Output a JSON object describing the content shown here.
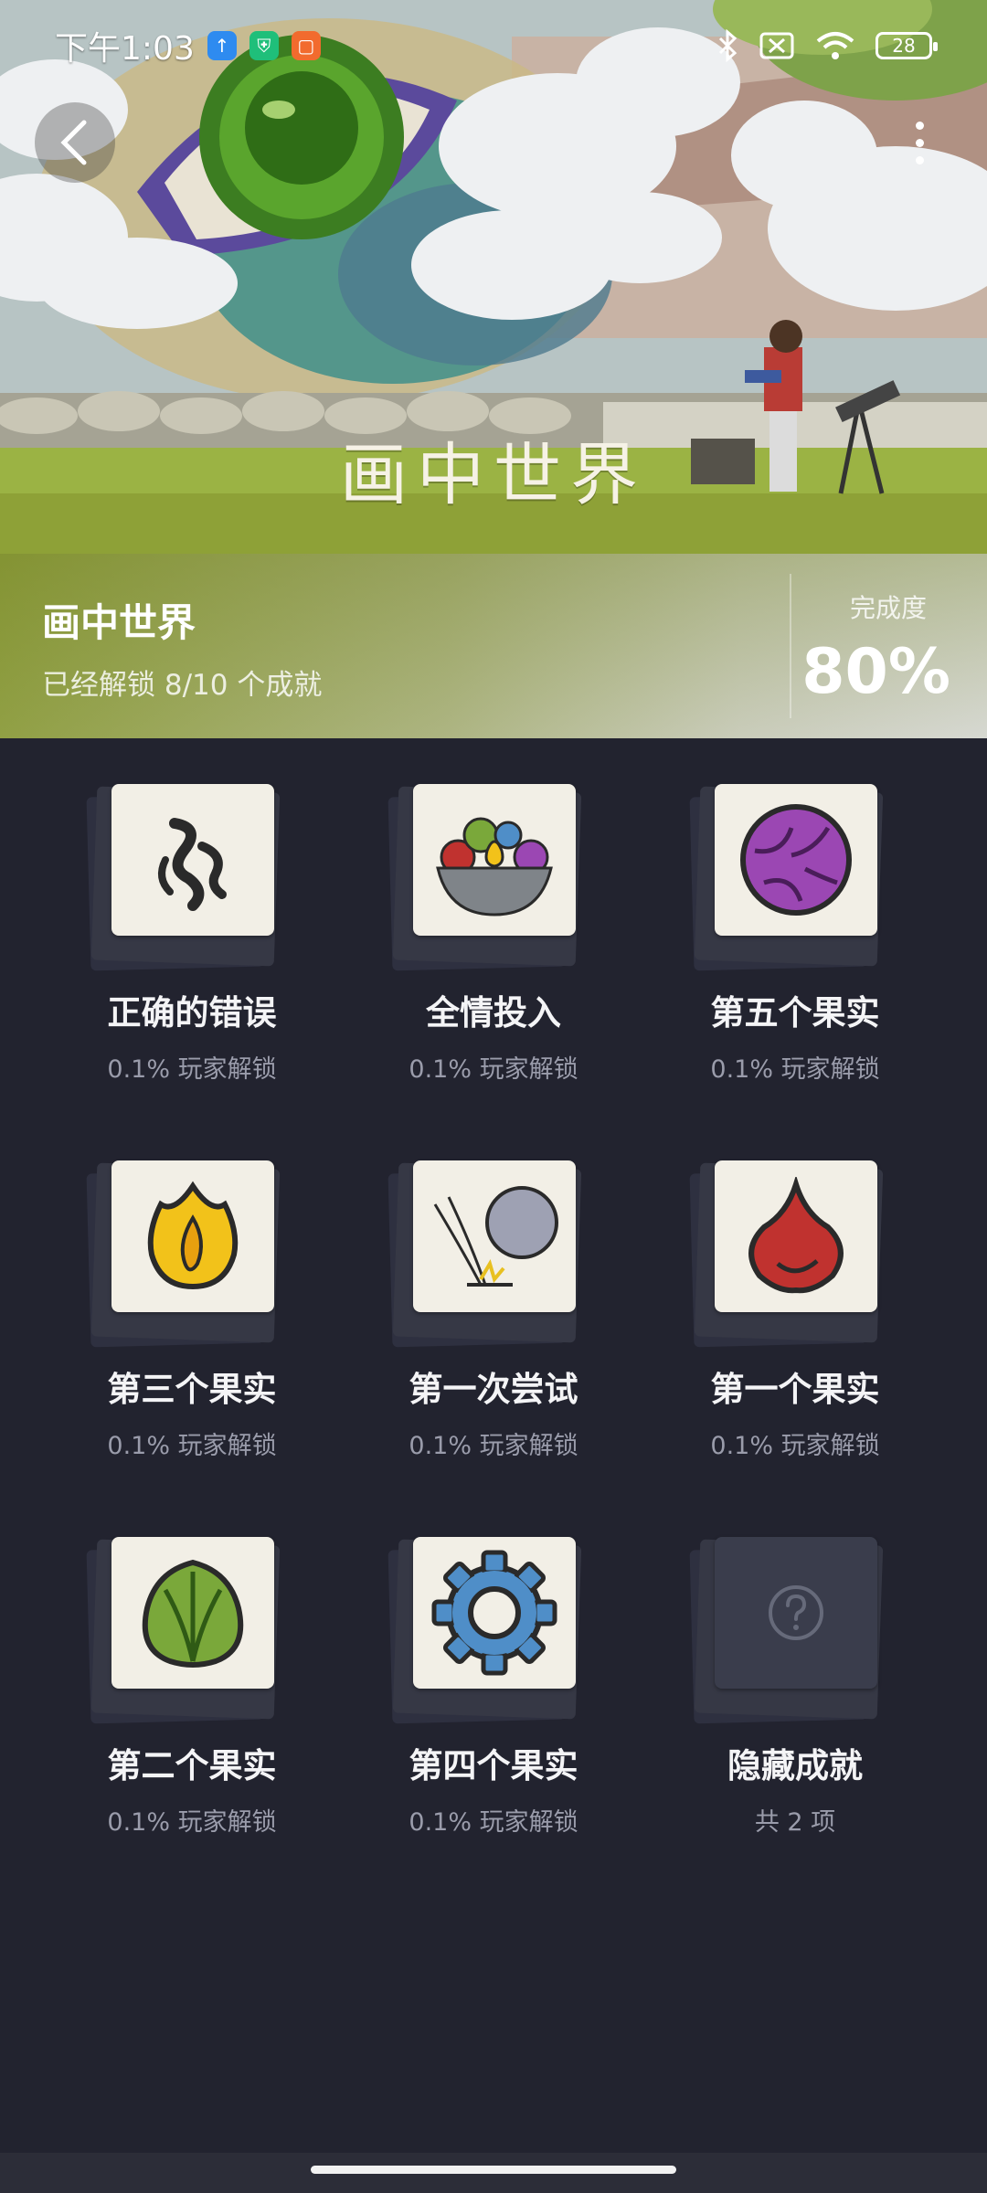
{
  "status_bar": {
    "time": "下午1:03",
    "battery": "28",
    "icons": [
      "upload-app-icon",
      "shield-app-icon",
      "shop-app-icon",
      "bluetooth-icon",
      "sim-icon",
      "wifi-icon",
      "battery-icon"
    ]
  },
  "hero": {
    "title": "画中世界"
  },
  "game": {
    "name": "画中世界",
    "unlock_summary": "已经解锁 8/10 个成就",
    "completion_label": "完成度",
    "completion_value": "80%"
  },
  "achievements": [
    {
      "name": "正确的错误",
      "rate": "0.1% 玩家解锁",
      "icon": "squiggle-glyph-icon"
    },
    {
      "name": "全情投入",
      "rate": "0.1% 玩家解锁",
      "icon": "fruit-bowl-icon"
    },
    {
      "name": "第五个果实",
      "rate": "0.1% 玩家解锁",
      "icon": "purple-fruit-icon"
    },
    {
      "name": "第三个果实",
      "rate": "0.1% 玩家解锁",
      "icon": "flame-fruit-icon"
    },
    {
      "name": "第一次尝试",
      "rate": "0.1% 玩家解锁",
      "icon": "thrown-stone-icon"
    },
    {
      "name": "第一个果实",
      "rate": "0.1% 玩家解锁",
      "icon": "red-fruit-icon"
    },
    {
      "name": "第二个果实",
      "rate": "0.1% 玩家解锁",
      "icon": "green-leaf-fruit-icon"
    },
    {
      "name": "第四个果实",
      "rate": "0.1% 玩家解锁",
      "icon": "gear-fruit-icon"
    },
    {
      "name": "隐藏成就",
      "rate": "共 2 项",
      "icon": "question-mark-icon"
    }
  ],
  "colors": {
    "background": "#22232f",
    "tile": "#f2efe6",
    "rate_text": "#9a9cab"
  }
}
